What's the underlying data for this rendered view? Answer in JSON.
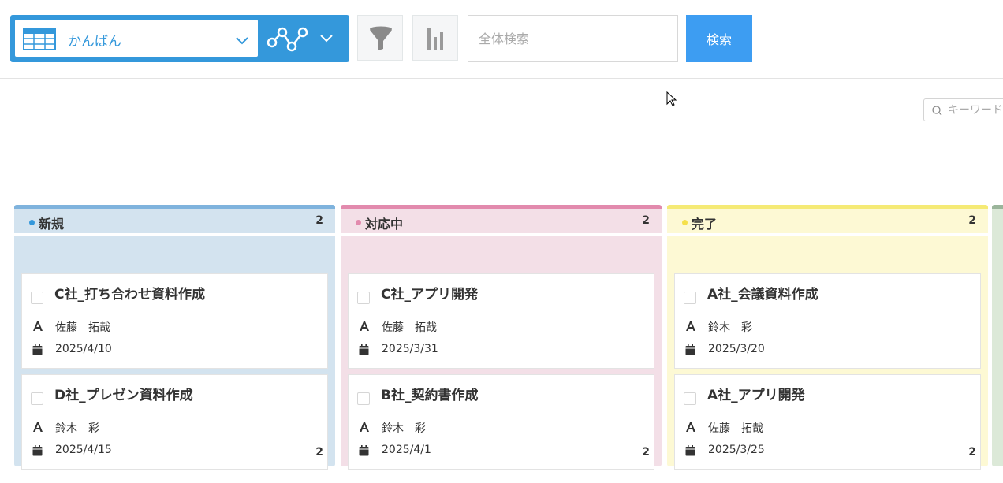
{
  "toolbar": {
    "view_name": "かんばん",
    "search_placeholder": "全体検索",
    "search_button": "検索",
    "brand_color": "#3498db",
    "search_button_color": "#3d9df2"
  },
  "keyword_search": {
    "placeholder": "キーワード"
  },
  "columns": [
    {
      "title": "新規",
      "count": "2",
      "footer_count": "2",
      "accent": "#7fb3dd",
      "bg": "#d3e3ef",
      "cards": [
        {
          "title": "C社_打ち合わせ資料作成",
          "user": "佐藤　拓哉",
          "date": "2025/4/10"
        },
        {
          "title": "D社_プレゼン資料作成",
          "user": "鈴木　彩",
          "date": "2025/4/15"
        }
      ]
    },
    {
      "title": "対応中",
      "count": "2",
      "footer_count": "2",
      "accent": "#e28aad",
      "bg": "#f3dfe7",
      "cards": [
        {
          "title": "C社_アプリ開発",
          "user": "佐藤　拓哉",
          "date": "2025/3/31"
        },
        {
          "title": "B社_契約書作成",
          "user": "鈴木　彩",
          "date": "2025/4/1"
        }
      ]
    },
    {
      "title": "完了",
      "count": "2",
      "footer_count": "2",
      "accent": "#f5ea75",
      "bg": "#fdf9d4",
      "cards": [
        {
          "title": "A社_会議資料作成",
          "user": "鈴木　彩",
          "date": "2025/3/20"
        },
        {
          "title": "A社_アプリ開発",
          "user": "佐藤　拓哉",
          "date": "2025/3/25"
        }
      ]
    }
  ]
}
